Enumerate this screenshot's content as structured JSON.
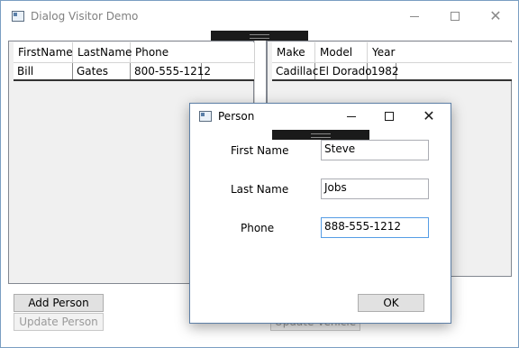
{
  "main_window": {
    "title": "Dialog Visitor Demo",
    "minimize_glyph": "",
    "maximize_glyph": "",
    "close_glyph": "✕"
  },
  "person_grid": {
    "columns": [
      "FirstName",
      "LastName",
      "Phone"
    ],
    "rows": [
      [
        "Bill",
        "Gates",
        "800-555-1212"
      ]
    ]
  },
  "car_grid": {
    "columns": [
      "Make",
      "Model",
      "Year"
    ],
    "rows": [
      [
        "Cadillac",
        "El Dorado",
        "1982"
      ]
    ]
  },
  "buttons": {
    "add_person": "Add Person",
    "update_person": "Update Person",
    "update_vehicle": "Update Vehicle"
  },
  "dialog": {
    "title": "Person",
    "close_glyph": "✕",
    "fields": [
      {
        "label": "First Name",
        "value": "Steve"
      },
      {
        "label": "Last Name",
        "value": "Jobs"
      },
      {
        "label": "Phone",
        "value": "888-555-1212"
      }
    ],
    "ok_label": "OK"
  }
}
